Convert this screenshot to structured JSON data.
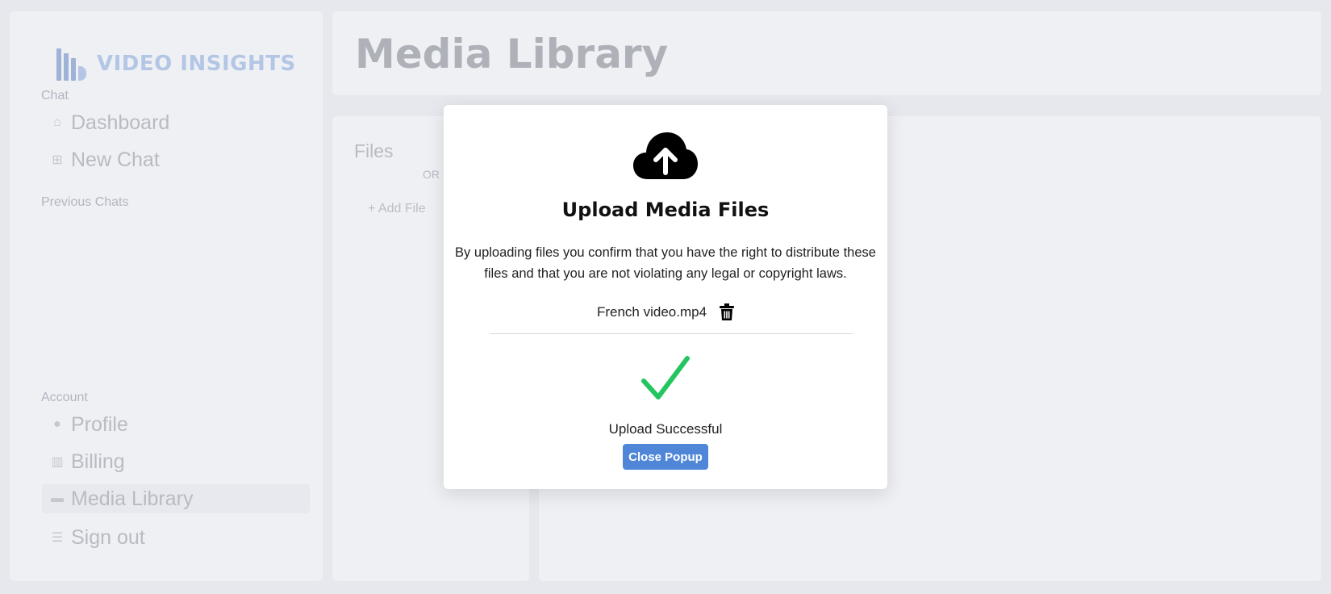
{
  "app": {
    "logo_text": "VIDEO INSIGHTS",
    "page_title": "Media Library"
  },
  "sidebar": {
    "chat_section_label": "Chat",
    "chat_items": [
      {
        "label": "Dashboard",
        "icon": "home-icon"
      },
      {
        "label": "New Chat",
        "icon": "grid-icon"
      }
    ],
    "previous_chats_label": "Previous Chats",
    "account_section_label": "Account",
    "account_items": [
      {
        "label": "Profile",
        "icon": "user-icon"
      },
      {
        "label": "Billing",
        "icon": "barcode-icon"
      },
      {
        "label": "Media Library",
        "icon": "folder-icon",
        "active": true
      },
      {
        "label": "Sign out",
        "icon": "logout-icon"
      }
    ]
  },
  "files_panel": {
    "title": "Files",
    "or_label": "OR",
    "add_file_label": "+ Add File"
  },
  "modal": {
    "title": "Upload Media Files",
    "disclaimer": "By uploading files you confirm that you have the right to distribute these files and that you are not violating any legal or copyright laws.",
    "file_name": "French video.mp4",
    "status": "Upload Successful",
    "close_label": "Close Popup"
  },
  "colors": {
    "accent": "#4f86d8",
    "success": "#22c55e",
    "logo": "#b4c6e6"
  }
}
